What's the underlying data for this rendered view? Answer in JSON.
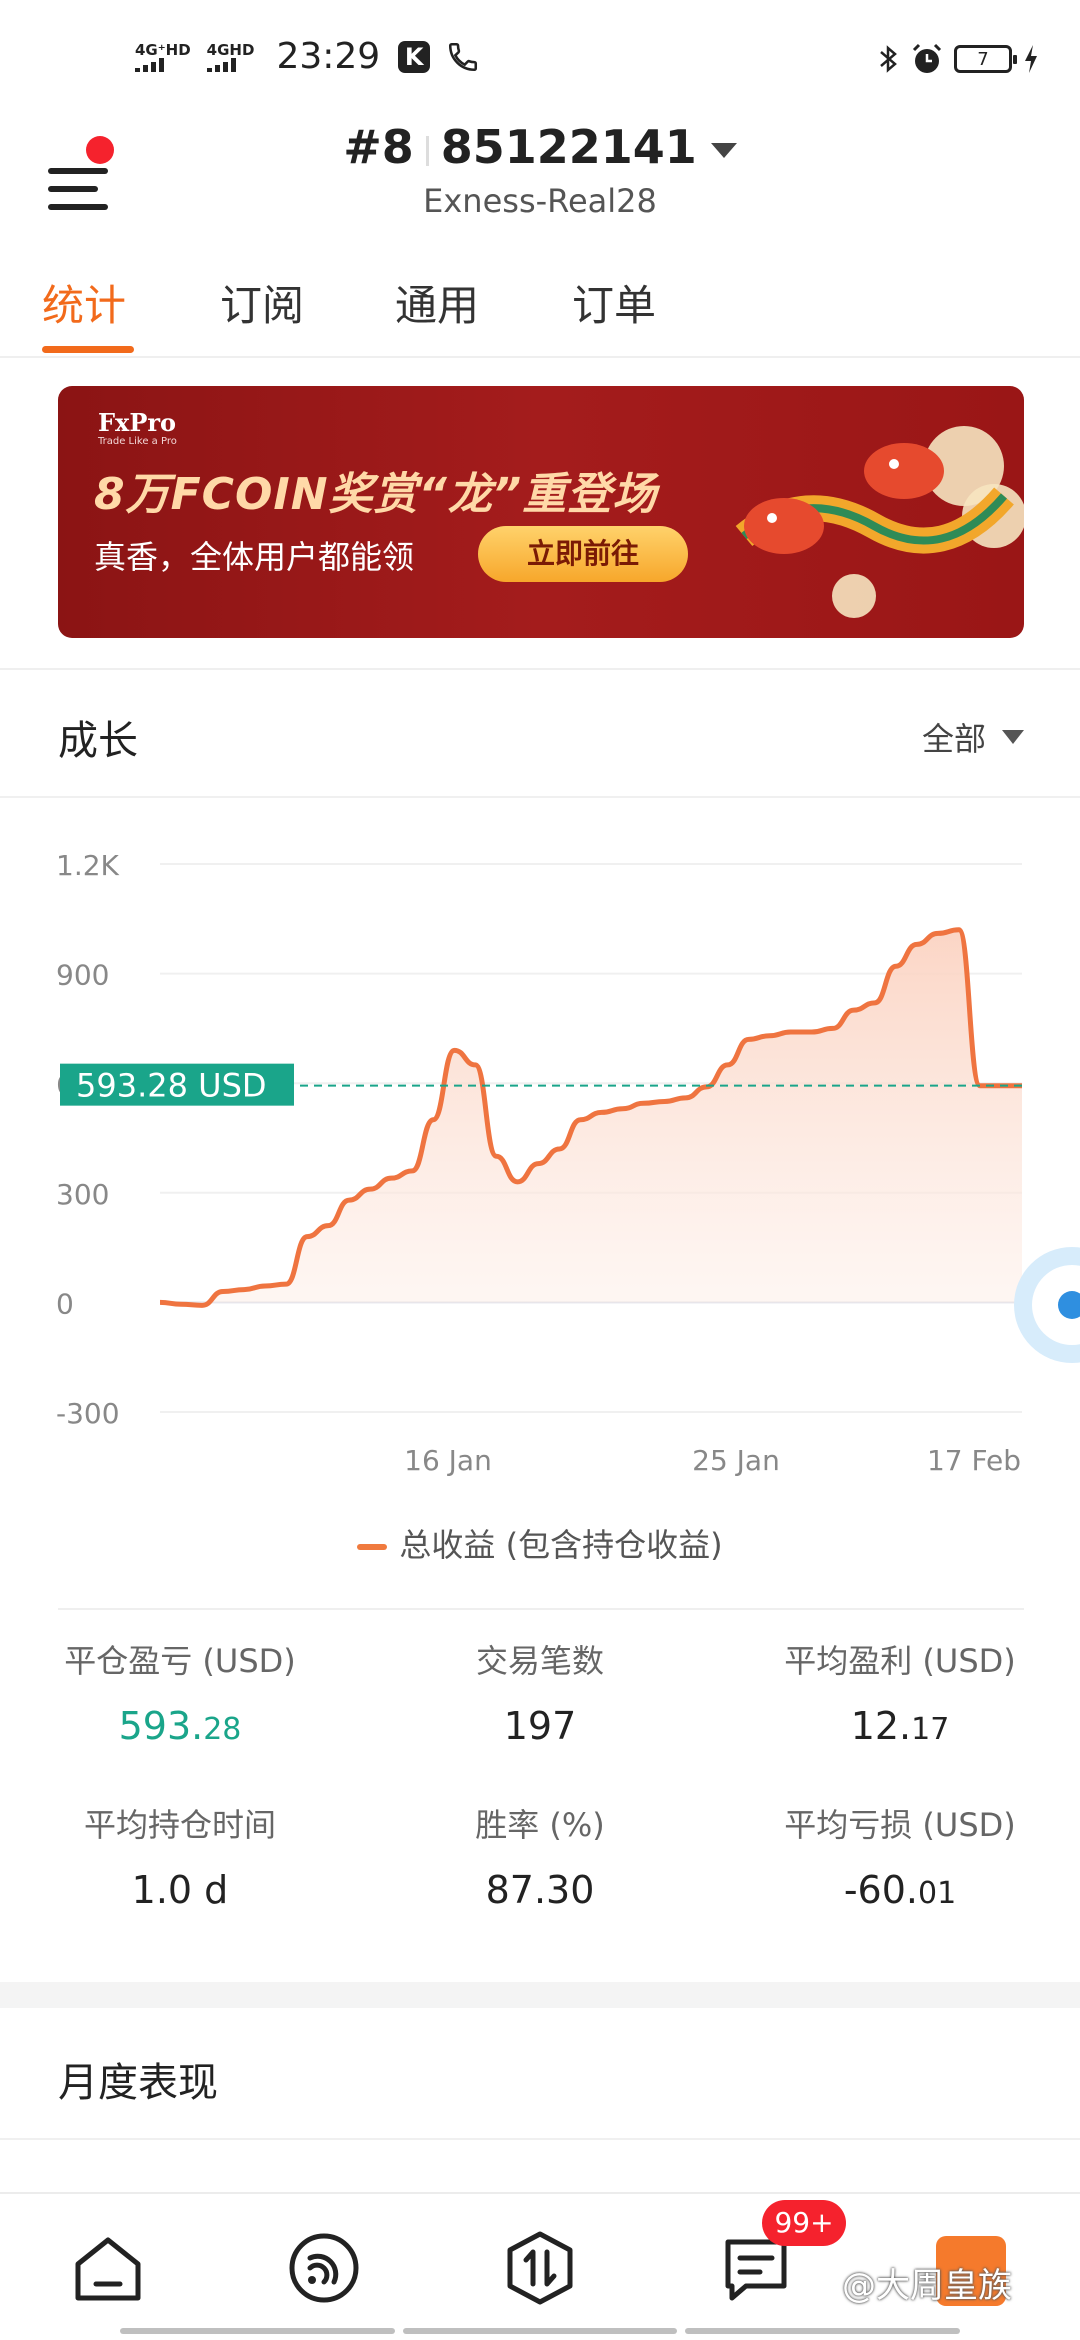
{
  "status_bar": {
    "net1": "4G⁺HD",
    "net2": "4GHD",
    "time": "23:29",
    "k_icon": "K",
    "battery": "7"
  },
  "header": {
    "account_index": "#8",
    "account_number": "85122141",
    "server": "Exness-Real28"
  },
  "tabs": [
    {
      "label": "统计",
      "active": true
    },
    {
      "label": "订阅",
      "active": false
    },
    {
      "label": "通用",
      "active": false
    },
    {
      "label": "订单",
      "active": false
    }
  ],
  "banner": {
    "logo": "FxPro",
    "logo_sub": "Trade Like a Pro",
    "headline": "8万FCOIN奖赏“龙”重登场",
    "subtitle": "真香，全体用户都能领",
    "cta": "立即前往"
  },
  "growth": {
    "title": "成长",
    "filter": "全部"
  },
  "chart_data": {
    "type": "area",
    "y_ticks": [
      "1.2K",
      "900",
      "600",
      "300",
      "0",
      "-300"
    ],
    "ylim": [
      -300,
      1200
    ],
    "x_ticks": [
      "16 Jan",
      "25 Jan",
      "17 Feb"
    ],
    "current_label": "593.28 USD",
    "current_value": 593.28,
    "series": [
      {
        "name": "总收益 (包含持仓收益)",
        "values": [
          0,
          -5,
          -8,
          30,
          35,
          45,
          50,
          180,
          210,
          280,
          310,
          340,
          360,
          500,
          690,
          650,
          400,
          330,
          380,
          420,
          500,
          520,
          530,
          545,
          550,
          560,
          590,
          650,
          720,
          730,
          740,
          740,
          750,
          800,
          820,
          920,
          980,
          1010,
          1020,
          593,
          593,
          593
        ]
      }
    ],
    "colors": {
      "line": "#ef7440",
      "fill": "#fbd3c2",
      "current": "#1aa58a"
    },
    "grid": true,
    "legend": "bottom-center"
  },
  "legend_label": "总收益 (包含持仓收益)",
  "stats": [
    {
      "label": "平仓盈亏 (USD)",
      "value_main": "593.",
      "value_dec": "28",
      "positive": true
    },
    {
      "label": "交易笔数",
      "value_main": "197",
      "value_dec": ""
    },
    {
      "label": "平均盈利 (USD)",
      "value_main": "12.",
      "value_dec": "17"
    },
    {
      "label": "平均持仓时间",
      "value_main": "1.0 d",
      "value_dec": ""
    },
    {
      "label": "胜率 (%)",
      "value_main": "87.30",
      "value_dec": ""
    },
    {
      "label": "平均亏损 (USD)",
      "value_main": "-60.",
      "value_dec": "01"
    }
  ],
  "monthly": {
    "title": "月度表现"
  },
  "bottom_nav": {
    "badge": "99+",
    "watermark": "@大周皇族",
    "items": [
      "home-icon",
      "signal-icon",
      "trade-icon",
      "messages-icon",
      "profile-icon"
    ]
  }
}
